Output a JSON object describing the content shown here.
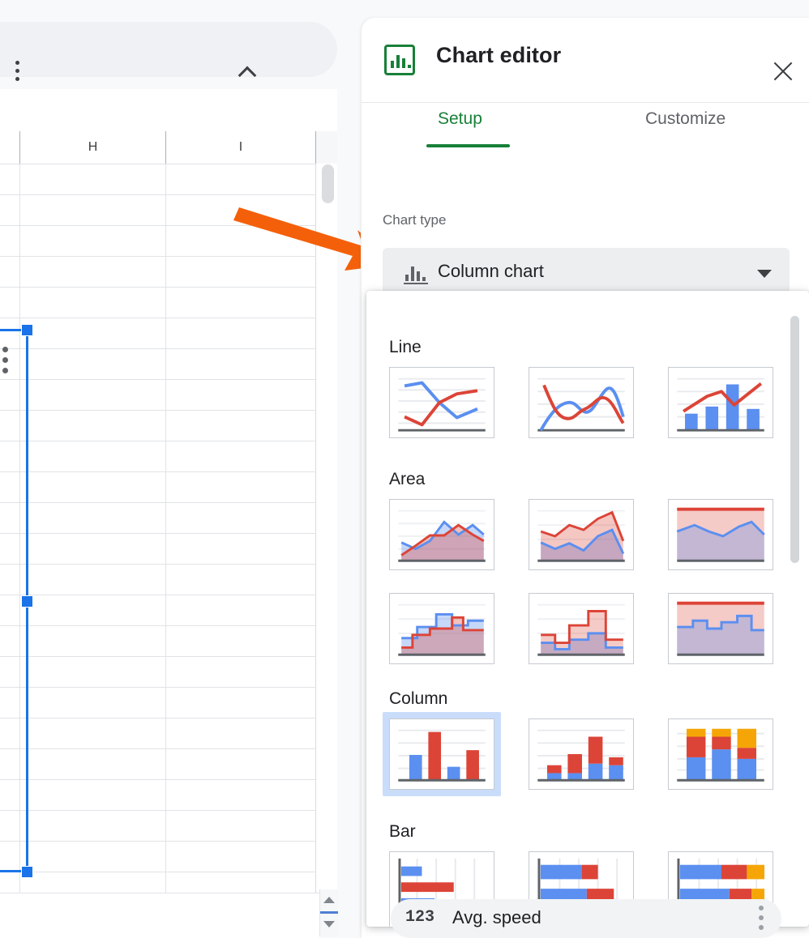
{
  "spreadsheet": {
    "column_headers": [
      "",
      "H",
      "I",
      ""
    ],
    "toolbar": {
      "caret_icon": "chevron-down-icon",
      "more_icon": "kebab-menu-icon",
      "collapse_icon": "chevron-up-icon"
    },
    "annotation": {
      "arrow_color": "#f4600a"
    },
    "scroll": {
      "up_icon": "scroll-up-arrow",
      "down_icon": "scroll-down-arrow"
    }
  },
  "panel": {
    "title": "Chart editor",
    "app_icon": "bar-chart-icon",
    "close_icon": "close-icon",
    "tabs": [
      {
        "label": "Setup",
        "active": true
      },
      {
        "label": "Customize",
        "active": false
      }
    ],
    "chart_type": {
      "label": "Chart type",
      "selected": "Column chart",
      "icon": "column-chart-icon",
      "caret_icon": "chevron-down-icon"
    },
    "dropdown": {
      "groups": [
        {
          "name": "Line",
          "options": [
            {
              "id": "line",
              "selected": false
            },
            {
              "id": "smooth-line",
              "selected": false
            },
            {
              "id": "combo",
              "selected": false
            }
          ]
        },
        {
          "name": "Area",
          "options": [
            {
              "id": "area",
              "selected": false
            },
            {
              "id": "stacked-area",
              "selected": false
            },
            {
              "id": "100-stacked-area",
              "selected": false
            },
            {
              "id": "stepped-area",
              "selected": false
            },
            {
              "id": "stacked-stepped-area",
              "selected": false
            },
            {
              "id": "100-stacked-stepped-area",
              "selected": false
            }
          ]
        },
        {
          "name": "Column",
          "options": [
            {
              "id": "column",
              "selected": true
            },
            {
              "id": "stacked-column",
              "selected": false
            },
            {
              "id": "100-stacked-column",
              "selected": false
            }
          ]
        },
        {
          "name": "Bar",
          "options": [
            {
              "id": "bar",
              "selected": false
            },
            {
              "id": "stacked-bar",
              "selected": false
            },
            {
              "id": "100-stacked-bar",
              "selected": false
            }
          ]
        }
      ]
    }
  },
  "bottom_chip": {
    "type_badge": "123",
    "label": "Avg. speed",
    "more_icon": "kebab-menu-icon"
  },
  "colors": {
    "accent_green": "#188038",
    "series_blue": "#5b8ff0",
    "series_red": "#dc4437",
    "series_yellow": "#f5a606",
    "selection_blue": "#1a73e8",
    "arrow_orange": "#f4600a"
  }
}
